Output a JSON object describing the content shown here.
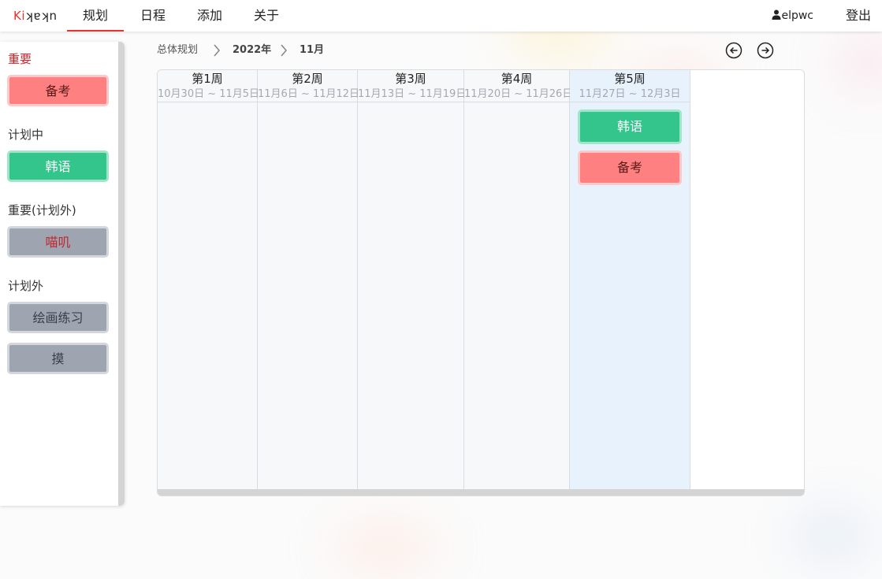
{
  "app": {
    "logo_ki": "Ki",
    "logo_rest": "ʞɐʞn"
  },
  "nav": {
    "plan": "规划",
    "schedule": "日程",
    "add": "添加",
    "about": "关于"
  },
  "user": {
    "name": "elpwc",
    "logout": "登出"
  },
  "sidebar": {
    "important_label": "重要",
    "important_item": "备考",
    "planned_label": "计划中",
    "planned_item": "韩语",
    "important_unplanned_label": "重要(计划外)",
    "important_unplanned_item": "喵叽",
    "unplanned_label": "计划外",
    "unplanned_item_1": "绘画练习",
    "unplanned_item_2": "摸"
  },
  "breadcrumb": {
    "root": "总体规划",
    "year": "2022年",
    "month": "11月"
  },
  "weeks": [
    {
      "title": "第1周",
      "range": "10月30日 ~ 11月5日"
    },
    {
      "title": "第2周",
      "range": "11月6日 ~ 11月12日"
    },
    {
      "title": "第3周",
      "range": "11月13日 ~ 11月19日"
    },
    {
      "title": "第4周",
      "range": "11月20日 ~ 11月26日"
    },
    {
      "title": "第5周",
      "range": "11月27日 ~ 12月3日"
    }
  ],
  "week5_tasks": {
    "task_1": "韩语",
    "task_2": "备考"
  },
  "colors": {
    "accent": "#e5342f",
    "pink": "#fe8080",
    "green": "#33c58b",
    "gray": "#9ea4b0",
    "current_week": "#e8f2fd"
  }
}
